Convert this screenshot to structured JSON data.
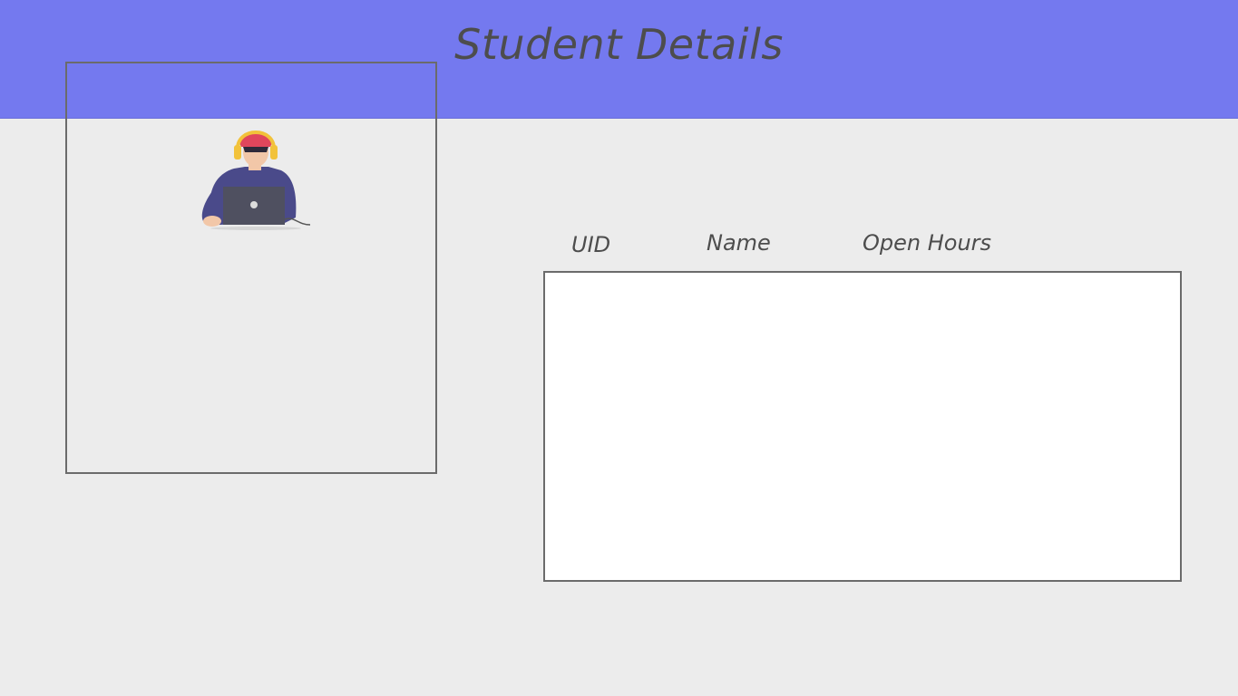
{
  "header": {
    "title": "Student Details",
    "background_color": "#7479ef"
  },
  "profile": {
    "avatar_icon": "student-with-headphones-laptop-illustration"
  },
  "table": {
    "columns": [
      "UID",
      "Name",
      "Open Hours"
    ],
    "rows": []
  }
}
